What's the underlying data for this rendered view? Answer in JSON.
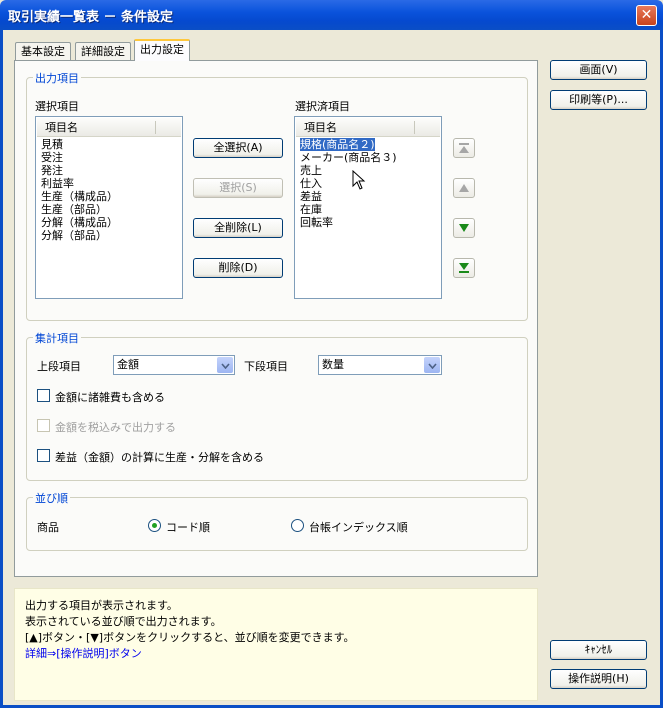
{
  "window": {
    "title": "取引実績一覧表 － 条件設定",
    "close_glyph": "✕"
  },
  "tabs": [
    {
      "label": "基本設定",
      "active": false
    },
    {
      "label": "詳細設定",
      "active": false
    },
    {
      "label": "出力設定",
      "active": true
    }
  ],
  "output_items": {
    "group_label": "出力項目",
    "available": {
      "label": "選択項目",
      "column_header": "項目名",
      "items": [
        "見積",
        "受注",
        "発注",
        "利益率",
        "生産（構成品）",
        "生産（部品）",
        "分解（構成品）",
        "分解（部品）"
      ]
    },
    "selected": {
      "label": "選択済項目",
      "column_header": "項目名",
      "items": [
        "規格(商品名２)",
        "メーカー(商品名３)",
        "売上",
        "仕入",
        "差益",
        "在庫",
        "回転率"
      ],
      "selected_index": 0
    },
    "buttons": {
      "select_all": "全選択(A)",
      "select": "選択(S)",
      "delete_all": "全削除(L)",
      "delete": "削除(D)"
    },
    "order_buttons": [
      {
        "icon": "move-top-icon",
        "enabled": false
      },
      {
        "icon": "move-up-icon",
        "enabled": false
      },
      {
        "icon": "move-down-icon",
        "enabled": true
      },
      {
        "icon": "move-bottom-icon",
        "enabled": true
      }
    ]
  },
  "aggregate": {
    "group_label": "集計項目",
    "upper_label": "上段項目",
    "upper_value": "金額",
    "lower_label": "下段項目",
    "lower_value": "数量",
    "checks": [
      {
        "label": "金額に諸雑費も含める",
        "checked": false,
        "enabled": true
      },
      {
        "label": "金額を税込みで出力する",
        "checked": false,
        "enabled": false
      },
      {
        "label": "差益（金額）の計算に生産・分解を含める",
        "checked": false,
        "enabled": true
      }
    ]
  },
  "sort": {
    "group_label": "並び順",
    "field_label": "商品",
    "options": [
      {
        "label": "コード順",
        "selected": true
      },
      {
        "label": "台帳インデックス順",
        "selected": false
      }
    ]
  },
  "help": {
    "lines": [
      "出力する項目が表示されます。",
      "表示されている並び順で出力されます。",
      "[▲]ボタン・[▼]ボタンをクリックすると、並び順を変更できます。"
    ],
    "link_text": "詳細⇒[操作説明]ボタン"
  },
  "side_buttons": {
    "screen": "画面(V)",
    "print": "印刷等(P)...",
    "cancel": "ｷｬﾝｾﾙ",
    "help": "操作説明(H)"
  },
  "colors": {
    "title_bar": "#0a53dc",
    "group_label": "#0046d5",
    "selection": "#316ac5",
    "arrow_enabled": "#1a8a1a",
    "arrow_disabled": "#a6a6a6"
  }
}
